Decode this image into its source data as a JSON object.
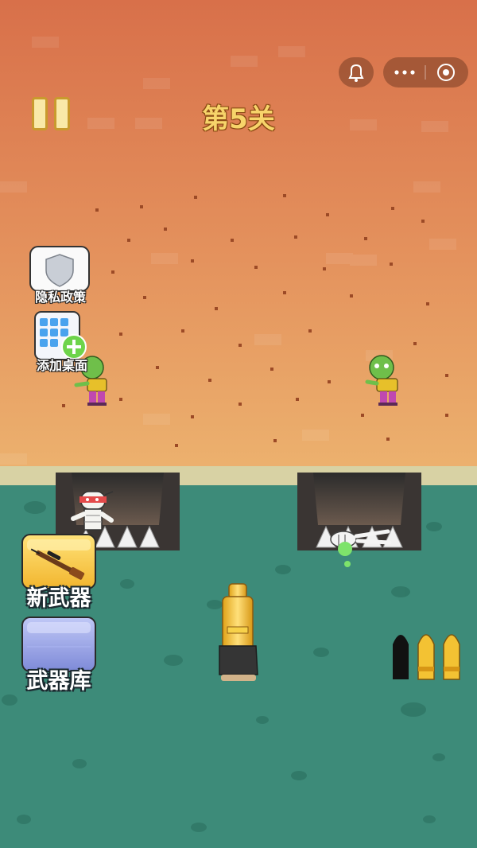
{
  "level": {
    "title": "第5关"
  },
  "capsule": {
    "more_icon": "more-dots-icon",
    "close_icon": "target-circle-icon",
    "notify_icon": "bell-icon"
  },
  "side_buttons": {
    "privacy": {
      "label": "隐私政策",
      "icon": "shield-icon"
    },
    "add_desktop": {
      "label": "添加桌面",
      "icon": "phone-add-icon"
    }
  },
  "weapon_buttons": {
    "new_weapon": {
      "label": "新武器",
      "icon": "sniper-rifle-icon"
    },
    "armory": {
      "label": "武器库",
      "icon": "armory-icon"
    }
  },
  "ammo": {
    "total": 3,
    "loaded": 2
  },
  "colors": {
    "wall_top": "#d9744a",
    "wall_bottom": "#e9a869",
    "water": "#3f8f7c",
    "gold": "#f3c233",
    "label_yellow": "#f7d46a"
  }
}
